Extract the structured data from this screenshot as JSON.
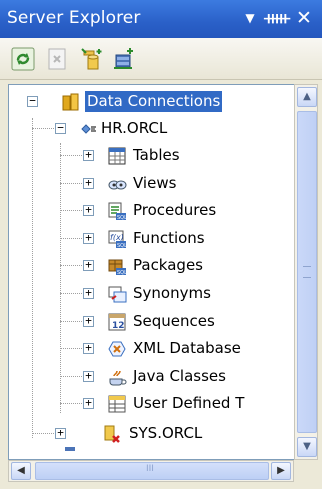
{
  "panel": {
    "title": "Server Explorer"
  },
  "titlebar": {
    "dropdown_icon": "dropdown-arrow-icon",
    "pin_icon": "pin-icon",
    "close_icon": "close-icon"
  },
  "toolbar": {
    "buttons": [
      {
        "name": "refresh-button",
        "icon": "refresh-icon"
      },
      {
        "name": "stop-refresh-button",
        "icon": "stop-icon"
      },
      {
        "name": "connect-to-database-button",
        "icon": "connect-database-icon"
      },
      {
        "name": "connect-to-server-button",
        "icon": "connect-server-icon"
      }
    ]
  },
  "tree": {
    "root": {
      "label": "Data Connections",
      "expander": "−"
    },
    "connection": {
      "label": "HR.ORCL",
      "expander": "−"
    },
    "children": [
      {
        "label": "Tables",
        "icon": "tables-icon",
        "expander": "+"
      },
      {
        "label": "Views",
        "icon": "views-icon",
        "expander": "+"
      },
      {
        "label": "Procedures",
        "icon": "procedures-icon",
        "expander": "+"
      },
      {
        "label": "Functions",
        "icon": "functions-icon",
        "expander": "+"
      },
      {
        "label": "Packages",
        "icon": "packages-icon",
        "expander": "+"
      },
      {
        "label": "Synonyms",
        "icon": "synonyms-icon",
        "expander": "+"
      },
      {
        "label": "Sequences",
        "icon": "sequences-icon",
        "expander": "+"
      },
      {
        "label": "XML Database",
        "icon": "xml-database-icon",
        "expander": "+"
      },
      {
        "label": "Java Classes",
        "icon": "java-classes-icon",
        "expander": "+"
      },
      {
        "label": "User Defined T",
        "icon": "user-defined-types-icon",
        "expander": "+"
      }
    ],
    "connection2": {
      "label": "SYS.ORCL",
      "expander": "+"
    }
  },
  "scrollbars": {
    "thumb_glyph": "III"
  }
}
